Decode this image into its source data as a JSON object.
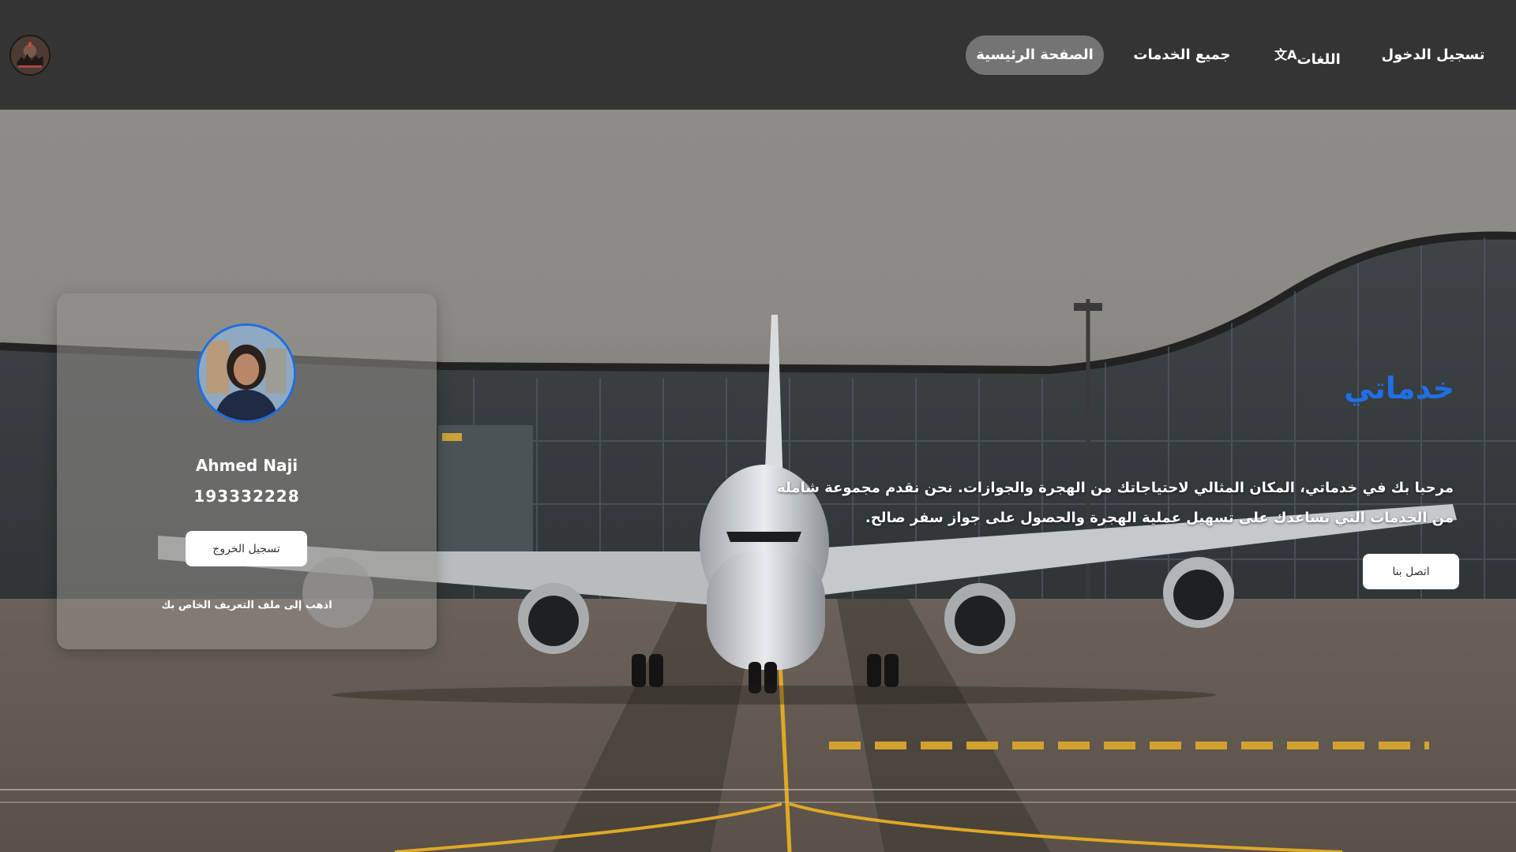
{
  "nav": {
    "login": "تسجيل الدخول",
    "languages": "اللغات",
    "language_icon": "translate-icon",
    "all_services": "جميع الخدمات",
    "home": "الصفحة الرئيسية",
    "logo_icon": "site-logo"
  },
  "profile": {
    "name": "Ahmed Naji",
    "id": "193332228",
    "logout": "تسجيل الخروج",
    "profile_link": "اذهب إلى ملف التعريف الخاص بك"
  },
  "hero": {
    "title": "خدماتي",
    "description": "مرحبا بك في خدماتي، المكان المثالي لاحتياجاتك من الهجرة والجوازات. نحن نقدم مجموعة شاملة من الخدمات التي تساعدك على تسهيل عملية الهجرة والحصول على جواز سفر صالح.",
    "contact": "اتصل بنا",
    "background": "airplane-on-runway-photo"
  },
  "colors": {
    "navbar": "#343434",
    "nav_active": "#747474",
    "title_blue": "#1f6fe6",
    "avatar_border": "#1e6fe0"
  }
}
